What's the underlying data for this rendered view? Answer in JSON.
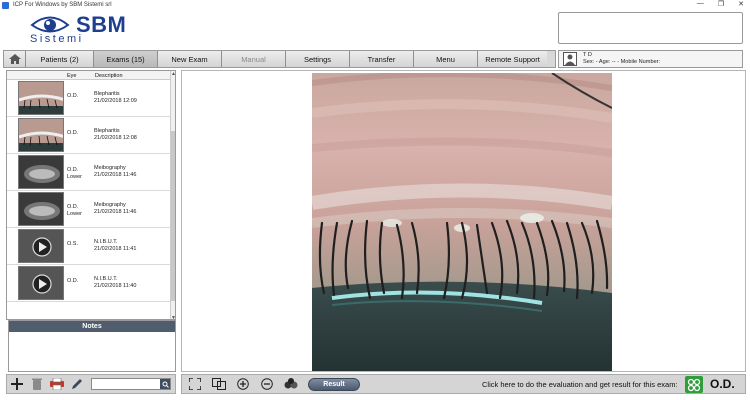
{
  "window": {
    "title": "ICP For Windows by SBM Sistemi srl",
    "controls": [
      "—",
      "❐",
      "✕"
    ]
  },
  "logo": {
    "brand": "SBM",
    "subtitle": "Sistemi"
  },
  "toolbar": {
    "items": [
      {
        "label": "Patients (2)",
        "state": "normal"
      },
      {
        "label": "Exams (15)",
        "state": "active"
      },
      {
        "label": "New Exam",
        "state": "normal"
      },
      {
        "label": "Manual",
        "state": "disabled"
      },
      {
        "label": "Settings",
        "state": "normal"
      },
      {
        "label": "Transfer",
        "state": "normal"
      },
      {
        "label": "Menu",
        "state": "normal"
      },
      {
        "label": "Remote Support",
        "state": "normal"
      }
    ]
  },
  "patient": {
    "name": "T D",
    "details": "Sex: - Age: -- - Mobile Number:"
  },
  "exam_list": {
    "headers": {
      "eye": "Eye",
      "description": "Description"
    },
    "rows": [
      {
        "eye": "O.D.",
        "eye2": "",
        "title": "Blepharitis",
        "date": "21/02/2018 12:09",
        "thumb": "photo"
      },
      {
        "eye": "O.D.",
        "eye2": "",
        "title": "Blepharitis",
        "date": "21/02/2018 12:08",
        "thumb": "photo"
      },
      {
        "eye": "O.D.",
        "eye2": "Lower",
        "title": "Meibography",
        "date": "21/02/2018 11:46",
        "thumb": "meibo"
      },
      {
        "eye": "O.D.",
        "eye2": "Lower",
        "title": "Meibography",
        "date": "21/02/2018 11:46",
        "thumb": "meibo"
      },
      {
        "eye": "O.S.",
        "eye2": "",
        "title": "N.I.B.U.T.",
        "date": "21/02/2018 11:41",
        "thumb": "video"
      },
      {
        "eye": "O.D.",
        "eye2": "",
        "title": "N.I.B.U.T.",
        "date": "21/02/2018 11:40",
        "thumb": "video"
      }
    ]
  },
  "notes": {
    "title": "Notes",
    "text": ""
  },
  "left_tools": {
    "icons": [
      "plus-icon",
      "trash-icon",
      "print-icon",
      "pen-icon",
      "search-icon"
    ],
    "search_placeholder": ""
  },
  "viewer_tools": {
    "icons": [
      "fullscreen-icon",
      "compare-icon",
      "zoom-in-icon",
      "zoom-out-icon",
      "filter-icon"
    ],
    "result_label": "Result",
    "evaluation_prompt": "Click here to do the evaluation and get result for this exam:",
    "eye": "O.D."
  },
  "colors": {
    "brand": "#1e3f8f",
    "notes_header": "#4f5d6e",
    "eval_button": "#2e9d3a"
  }
}
